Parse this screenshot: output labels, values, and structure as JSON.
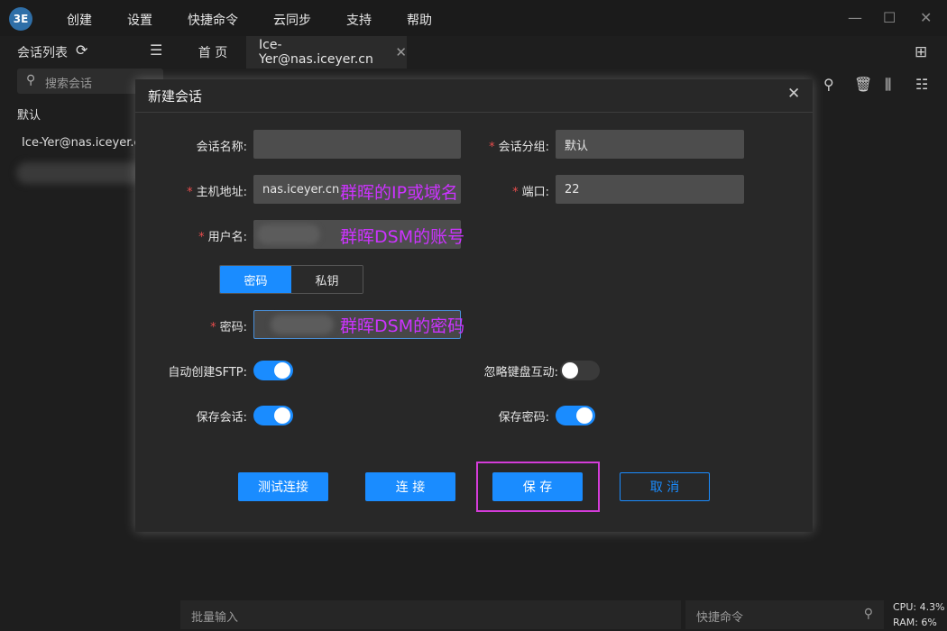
{
  "app": {
    "logo_text": "3E"
  },
  "menubar": {
    "items": [
      "创建",
      "设置",
      "快捷命令",
      "云同步",
      "支持",
      "帮助"
    ],
    "min": "—",
    "max": "☐",
    "close": "✕"
  },
  "sidebar": {
    "title": "会话列表",
    "search_placeholder": "搜索会话",
    "group": "默认",
    "session": "Ice-Yer@nas.iceyer.cn"
  },
  "tabs": {
    "home": "首 页",
    "active": "Ice-Yer@nas.iceyer.cn",
    "close": "✕"
  },
  "dialog": {
    "title": "新建会话",
    "close": "✕",
    "fields": {
      "name": {
        "label": "会话名称:",
        "value": ""
      },
      "group": {
        "label": "会话分组:",
        "value": "默认"
      },
      "host": {
        "label": "主机地址:",
        "value": "nas.iceyer.cn"
      },
      "port": {
        "label": "端口:",
        "value": "22"
      },
      "user": {
        "label": "用户名:",
        "value": ""
      },
      "pass": {
        "label": "密码:",
        "value": ""
      }
    },
    "auth": {
      "password": "密码",
      "key": "私钥"
    },
    "toggles": {
      "auto_sftp": {
        "label": "自动创建SFTP:",
        "on": true
      },
      "ignore_kbd": {
        "label": "忽略键盘互动:",
        "on": false
      },
      "save_session": {
        "label": "保存会话:",
        "on": true
      },
      "save_password": {
        "label": "保存密码:",
        "on": true
      }
    },
    "buttons": {
      "test": "测试连接",
      "connect": "连 接",
      "save": "保 存",
      "cancel": "取 消"
    }
  },
  "annotations": {
    "host": "群晖的IP或域名",
    "user": "群晖DSM的账号",
    "pass": "群晖DSM的密码"
  },
  "bottom": {
    "batch_placeholder": "批量输入",
    "quick_placeholder": "快捷命令",
    "cpu": "CPU: 4.3%",
    "ram": "RAM: 6%"
  },
  "colors": {
    "accent": "#1a8cff",
    "highlight": "#d43cd9",
    "annotation": "#cc33ff",
    "required": "#e84d4d"
  }
}
